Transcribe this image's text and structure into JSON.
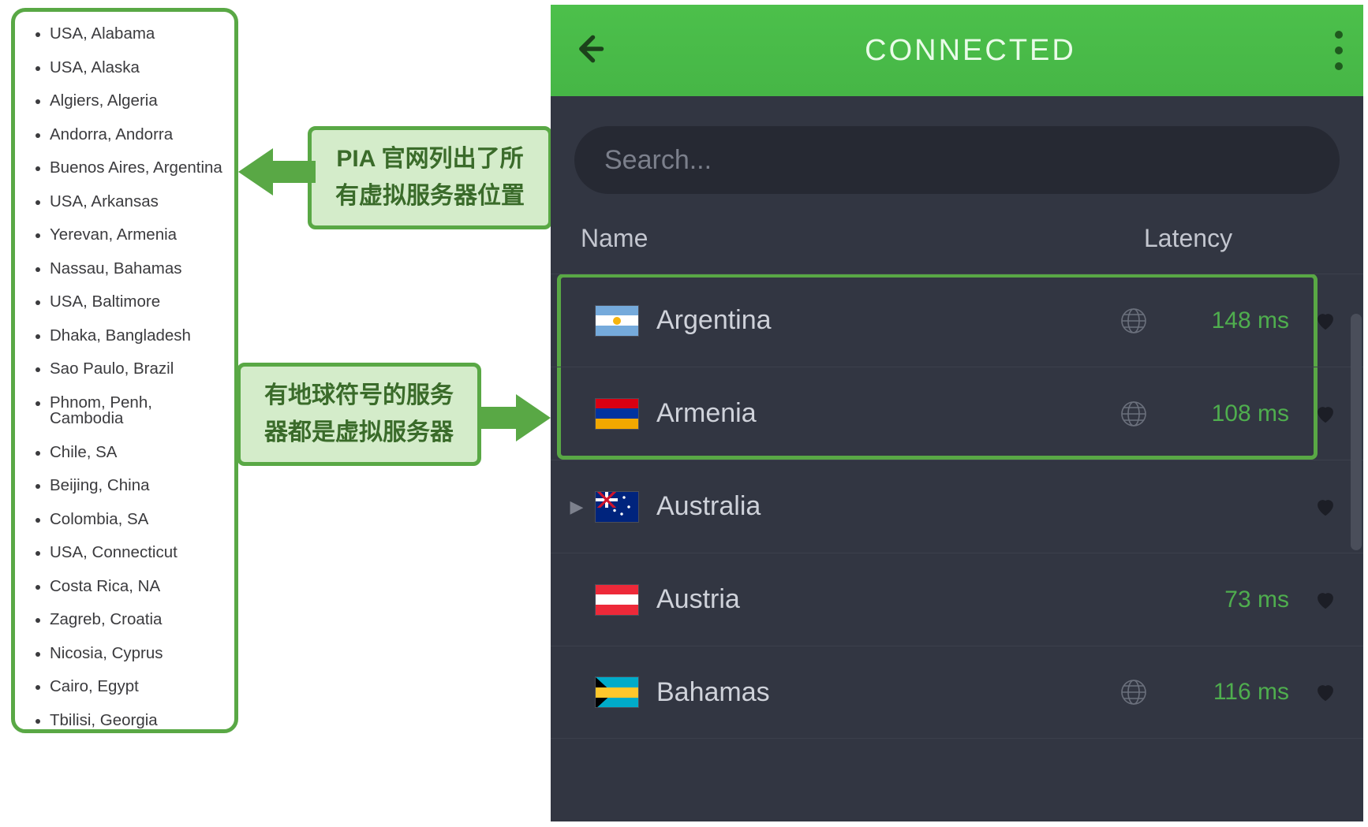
{
  "colors": {
    "accent_green": "#59a845",
    "callout_bg": "#d4ecca",
    "app_bg": "#323642",
    "header_green": "#4cc04b"
  },
  "left_list": {
    "items": [
      "USA, Alabama",
      "USA, Alaska",
      "Algiers, Algeria",
      "Andorra, Andorra",
      "Buenos Aires, Argentina",
      "USA, Arkansas",
      "Yerevan, Armenia",
      "Nassau, Bahamas",
      "USA, Baltimore",
      "Dhaka, Bangladesh",
      "Sao Paulo, Brazil",
      "Phnom, Penh, Cambodia",
      "Chile, SA",
      "Beijing, China",
      "Colombia, SA",
      "USA, Connecticut",
      "Costa Rica, NA",
      "Zagreb, Croatia",
      "Nicosia, Cyprus",
      "Cairo, Egypt",
      "Tbilisi, Georgia"
    ]
  },
  "callouts": {
    "one": "PIA 官网列出了所有虚拟服务器位置",
    "two": "有地球符号的服务器都是虚拟服务器"
  },
  "app": {
    "title": "CONNECTED",
    "search_placeholder": "Search...",
    "columns": {
      "name": "Name",
      "latency": "Latency"
    },
    "servers": [
      {
        "country": "Argentina",
        "flag": "ar",
        "virtual": true,
        "latency": "148 ms",
        "expandable": false
      },
      {
        "country": "Armenia",
        "flag": "am",
        "virtual": true,
        "latency": "108 ms",
        "expandable": false
      },
      {
        "country": "Australia",
        "flag": "au",
        "virtual": false,
        "latency": "",
        "expandable": true
      },
      {
        "country": "Austria",
        "flag": "at",
        "virtual": false,
        "latency": "73 ms",
        "expandable": false
      },
      {
        "country": "Bahamas",
        "flag": "bs",
        "virtual": true,
        "latency": "116 ms",
        "expandable": false
      }
    ]
  }
}
